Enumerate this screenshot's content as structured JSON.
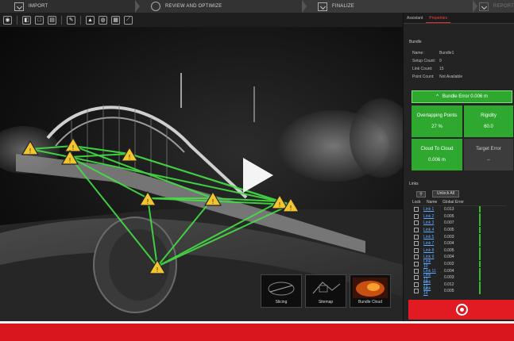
{
  "workflow": {
    "steps": [
      {
        "label": "IMPORT"
      },
      {
        "label": "REVIEW AND OPTIMIZE"
      },
      {
        "label": "FINALIZE"
      },
      {
        "label": "REPORT"
      }
    ]
  },
  "panel": {
    "tabs": [
      "Assistant",
      "Properties"
    ],
    "section_title": "Bundle",
    "properties": [
      {
        "key": "Name:",
        "value": "Bundle1"
      },
      {
        "key": "Setup Count:",
        "value": "9"
      },
      {
        "key": "Link Count:",
        "value": "15"
      },
      {
        "key": "Point Count:",
        "value": "Not Available"
      }
    ],
    "bundle_error": "Bundle Error 0.006 m",
    "tiles": [
      {
        "title": "Overlapping Points",
        "value": "27 %"
      },
      {
        "title": "Rigidity",
        "value": "60.0"
      },
      {
        "title": "Cloud To Cloud",
        "value": "0.006 m"
      },
      {
        "title": "Target Error",
        "value": "--"
      }
    ],
    "links_title": "Links",
    "unlock_all": "Unlock All",
    "table_headers": [
      "Lock",
      "Name",
      "Global Error"
    ],
    "links": [
      {
        "name": "Link 1",
        "error": "0.013"
      },
      {
        "name": "Link 2",
        "error": "0.005"
      },
      {
        "name": "Link 3",
        "error": "0.007"
      },
      {
        "name": "Link 4",
        "error": "0.005"
      },
      {
        "name": "Link 5",
        "error": "0.003"
      },
      {
        "name": "Link 7",
        "error": "0.004"
      },
      {
        "name": "Link 8",
        "error": "0.005"
      },
      {
        "name": "Link 9",
        "error": "0.004"
      },
      {
        "name": "Link 10",
        "error": "0.002"
      },
      {
        "name": "Link 11",
        "error": "0.004"
      },
      {
        "name": "Link 12",
        "error": "0.003"
      },
      {
        "name": "Link 13",
        "error": "0.012"
      },
      {
        "name": "Link 14",
        "error": "0.005"
      }
    ]
  },
  "thumbnails": [
    {
      "label": "Slicing"
    },
    {
      "label": "Sitemap"
    },
    {
      "label": "Bundle Cloud"
    }
  ],
  "colors": {
    "accent_red": "#e21a22",
    "green": "#2fa82f",
    "link_blue": "#5ea9ff"
  }
}
